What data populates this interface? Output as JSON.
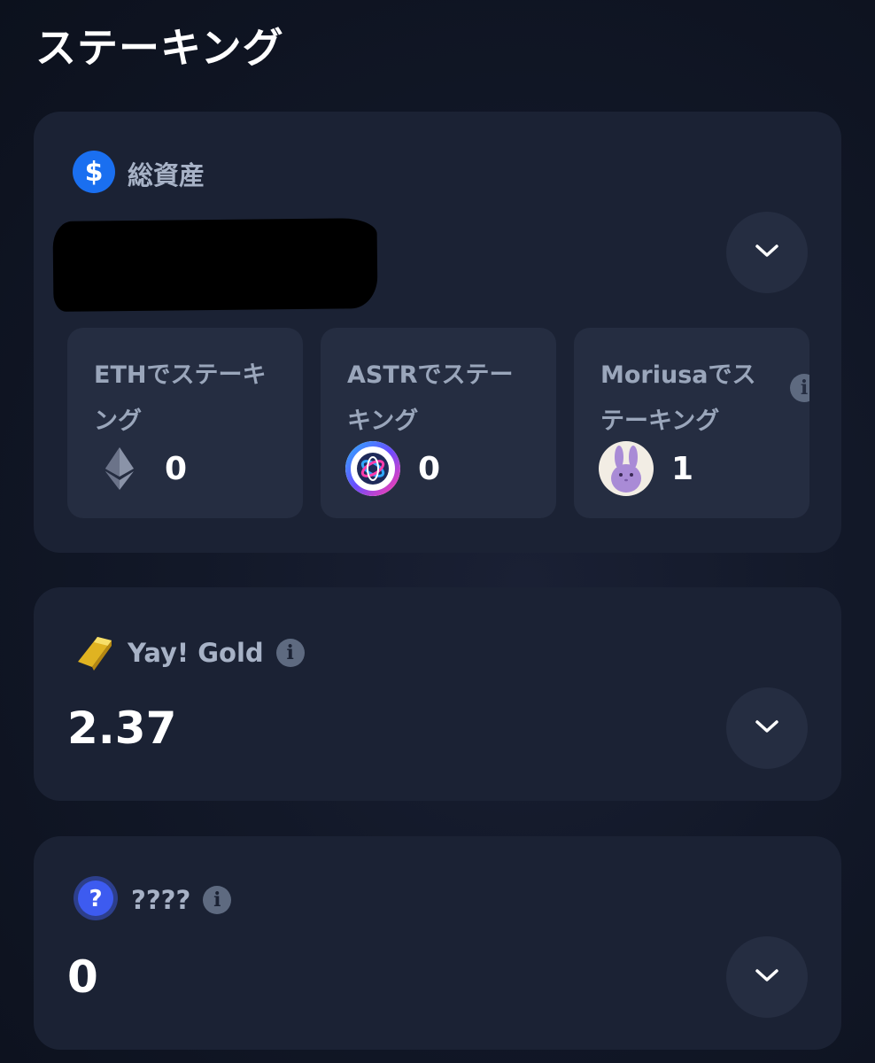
{
  "page": {
    "title": "ステーキング"
  },
  "total_assets": {
    "label": "総資産",
    "icon": "dollar-icon",
    "subcards": [
      {
        "label": "ETHでステーキング",
        "value": "0",
        "icon": "ethereum-icon"
      },
      {
        "label": "ASTRでステーキング",
        "value": "0",
        "icon": "astar-icon"
      },
      {
        "label": "Moriusaでステーキング",
        "value": "1",
        "icon": "moriusa-icon"
      }
    ]
  },
  "yay_gold": {
    "label": "Yay! Gold",
    "value": "2.37",
    "icon": "gold-bar-icon"
  },
  "unknown_asset": {
    "label": "????",
    "value": "0",
    "icon": "question-icon"
  },
  "colors": {
    "background": "#121828",
    "card": "#1b2234",
    "subcard": "#252d41",
    "label": "#a7b2c6",
    "accent_blue": "#1a6ff0"
  }
}
